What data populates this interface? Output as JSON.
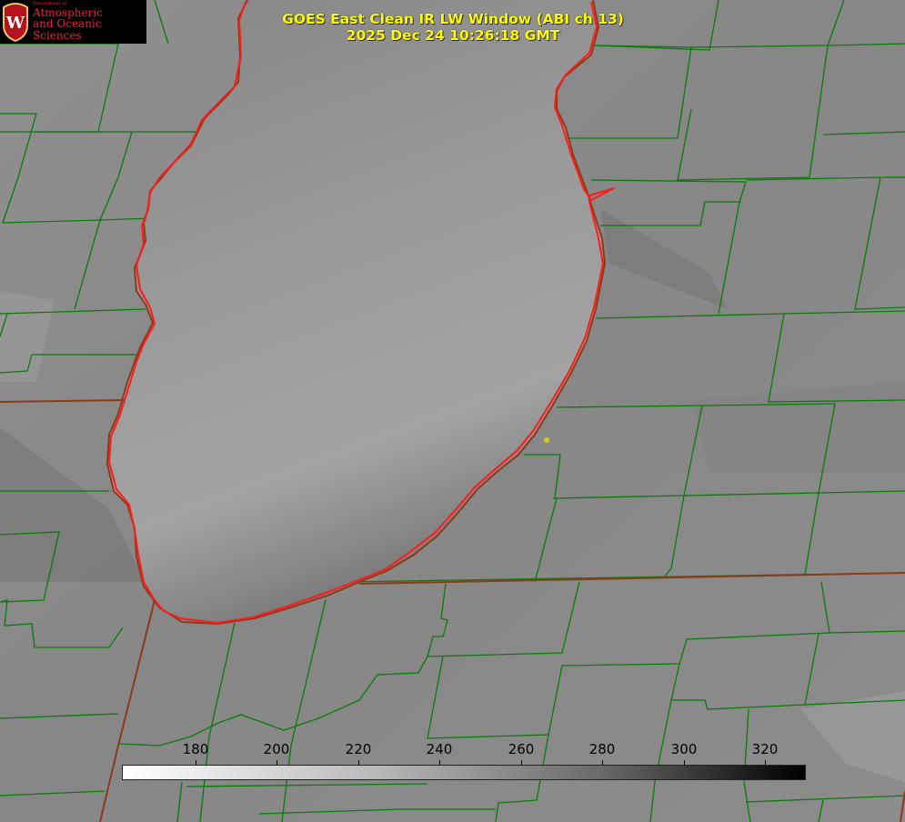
{
  "logo": {
    "department": "Department of",
    "line1": "Atmospheric",
    "line2": "and Oceanic Sciences",
    "seal_letter": "W",
    "brand_color": "#e8223a"
  },
  "title": {
    "line1": "GOES East Clean IR LW Window (ABI ch 13)",
    "line2": "2025 Dec 24 10:26:18 GMT",
    "color": "#ffff00"
  },
  "colorbar": {
    "ticks": [
      "180",
      "200",
      "220",
      "240",
      "260",
      "280",
      "300",
      "320"
    ],
    "colors": {
      "low": "#ffffff",
      "high": "#000000"
    }
  },
  "map": {
    "county_line_color": "#0a7a0a",
    "state_line_color": "#8b3a1a",
    "lake_outline_color": "#ff1a1a",
    "marker_color": "#d6c81a"
  }
}
